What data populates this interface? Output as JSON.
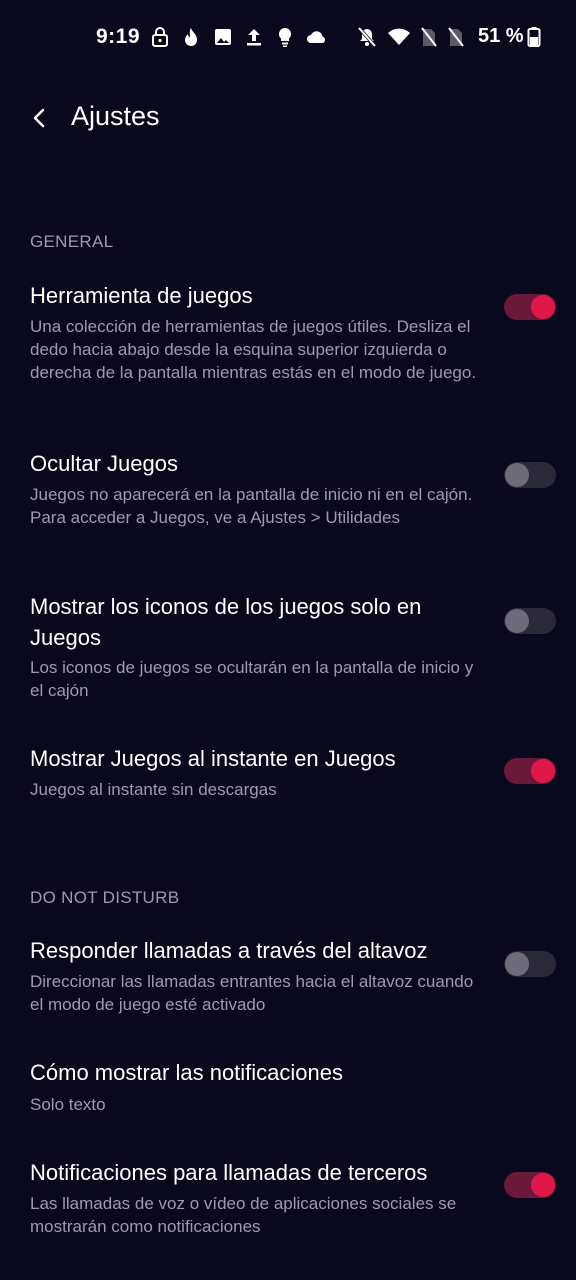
{
  "status_bar": {
    "time": "9:19",
    "battery": "51 %",
    "icons": [
      "lock-icon",
      "tinder-icon",
      "image-icon",
      "upload-icon",
      "lightbulb-icon",
      "cloud-icon",
      "bell-off-icon",
      "wifi-icon",
      "no-sim-icon",
      "no-sim-icon",
      "battery-icon"
    ]
  },
  "app_bar": {
    "back_icon": "back-arrow-icon",
    "title": "Ajustes"
  },
  "sections": {
    "general": {
      "header": "GENERAL",
      "items": [
        {
          "title": "Herramienta de juegos",
          "description": "Una colección de herramientas de juegos útiles. Desliza el dedo hacia abajo desde la esquina superior izquierda o derecha de la pantalla mientras estás en el modo de juego.",
          "toggle": true
        },
        {
          "title": "Ocultar Juegos",
          "description": "Juegos no aparecerá en la pantalla de inicio ni en el cajón. Para acceder a Juegos, ve a Ajustes > Utilidades",
          "toggle": false
        },
        {
          "title": "Mostrar los iconos de los juegos solo en Juegos",
          "description": "Los iconos de juegos se ocultarán en la pantalla de inicio y el cajón",
          "toggle": false
        },
        {
          "title": "Mostrar Juegos al instante en Juegos",
          "description": "Juegos al instante sin descargas",
          "toggle": true
        }
      ]
    },
    "dnd": {
      "header": "DO NOT DISTURB",
      "items": [
        {
          "title": "Responder llamadas a través del altavoz",
          "description": "Direccionar las llamadas entrantes hacia el altavoz cuando el modo de juego esté activado",
          "toggle": false
        },
        {
          "title": "Cómo mostrar las notificaciones",
          "description": "Solo texto"
        },
        {
          "title": "Notificaciones para llamadas de terceros",
          "description": "Las llamadas de voz o vídeo de aplicaciones sociales se mostrarán como notificaciones",
          "toggle": true
        }
      ]
    }
  },
  "colors": {
    "background": "#09081c",
    "accent": "#e0184a",
    "secondary_text": "#9e9cab"
  }
}
